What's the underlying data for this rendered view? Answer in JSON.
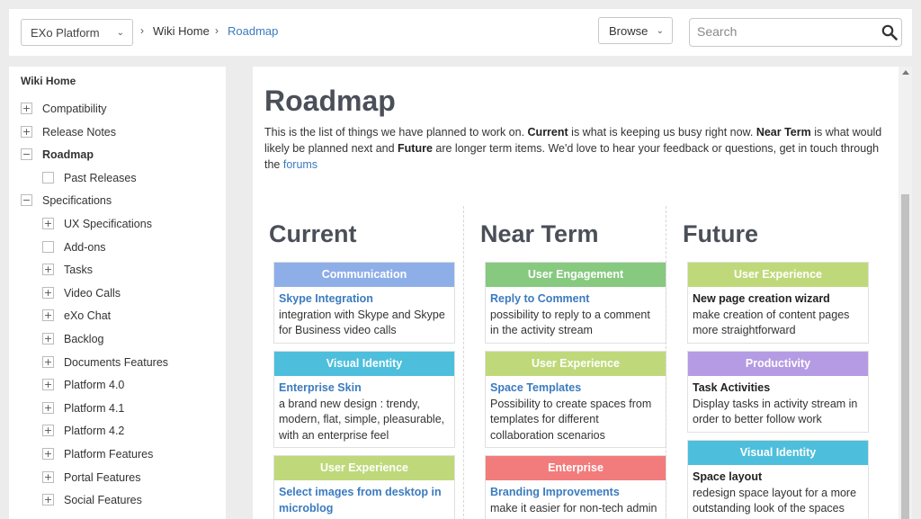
{
  "topbar": {
    "space_selector": "EXo Platform",
    "breadcrumb": [
      "Wiki Home",
      "Roadmap"
    ],
    "browse_label": "Browse",
    "search_placeholder": "Search"
  },
  "sidebar": {
    "title": "Wiki Home",
    "items": [
      {
        "label": "Compatibility",
        "toggle": "+",
        "level": 0,
        "bold": false
      },
      {
        "label": "Release Notes",
        "toggle": "+",
        "level": 0,
        "bold": false
      },
      {
        "label": "Roadmap",
        "toggle": "−",
        "level": 0,
        "bold": true
      },
      {
        "label": "Past Releases",
        "toggle": "",
        "level": 1,
        "bold": false
      },
      {
        "label": "Specifications",
        "toggle": "−",
        "level": 0,
        "bold": false
      },
      {
        "label": "UX Specifications",
        "toggle": "+",
        "level": 1,
        "bold": false
      },
      {
        "label": "Add-ons",
        "toggle": "",
        "level": 1,
        "bold": false
      },
      {
        "label": "Tasks",
        "toggle": "+",
        "level": 1,
        "bold": false
      },
      {
        "label": "Video Calls",
        "toggle": "+",
        "level": 1,
        "bold": false
      },
      {
        "label": "eXo Chat",
        "toggle": "+",
        "level": 1,
        "bold": false
      },
      {
        "label": "Backlog",
        "toggle": "+",
        "level": 1,
        "bold": false
      },
      {
        "label": "Documents Features",
        "toggle": "+",
        "level": 1,
        "bold": false
      },
      {
        "label": "Platform 4.0",
        "toggle": "+",
        "level": 1,
        "bold": false
      },
      {
        "label": "Platform 4.1",
        "toggle": "+",
        "level": 1,
        "bold": false
      },
      {
        "label": "Platform 4.2",
        "toggle": "+",
        "level": 1,
        "bold": false
      },
      {
        "label": "Platform Features",
        "toggle": "+",
        "level": 1,
        "bold": false
      },
      {
        "label": "Portal Features",
        "toggle": "+",
        "level": 1,
        "bold": false
      },
      {
        "label": "Social Features",
        "toggle": "+",
        "level": 1,
        "bold": false
      }
    ]
  },
  "main": {
    "title": "Roadmap",
    "intro": {
      "p1": "This is the list of things we have planned to work on. ",
      "b1": "Current",
      "p2": " is what is keeping us busy right now. ",
      "b2": "Near Term",
      "p3": " is what would likely be planned next and ",
      "b3": "Future",
      "p4": "  are longer term items. We'd love to hear your feedback or questions, get in touch through the ",
      "link": "forums"
    },
    "columns": [
      {
        "heading": "Current",
        "cards": [
          {
            "category": "Communication",
            "color": "#8eaee8",
            "title": "Skype Integration",
            "title_style": "link",
            "desc": " integration with Skype and Skype for Business video calls"
          },
          {
            "category": "Visual Identity",
            "color": "#4dbfdc",
            "title": "Enterprise Skin",
            "title_style": "link",
            "desc": " a brand new design : trendy, modern, flat, simple, pleasurable, with an enterprise feel"
          },
          {
            "category": "User Experience",
            "color": "#bfd97a",
            "title": "Select images from desktop in microblog",
            "title_style": "link",
            "desc": ""
          }
        ]
      },
      {
        "heading": "Near Term",
        "cards": [
          {
            "category": "User Engagement",
            "color": "#86c97f",
            "title": "Reply to Comment",
            "title_style": "link",
            "desc": "possibility to reply to a comment in the activity stream"
          },
          {
            "category": "User Experience",
            "color": "#bfd97a",
            "title": "Space Templates",
            "title_style": "link",
            "desc": "Possibility to create spaces from templates for different collaboration scenarios"
          },
          {
            "category": "Enterprise",
            "color": "#f27b7b",
            "title": "Branding Improvements",
            "title_style": "link",
            "desc": "make it easier for non-tech admin"
          }
        ]
      },
      {
        "heading": "Future",
        "cards": [
          {
            "category": "User Experience",
            "color": "#bfd97a",
            "title": "New page creation wizard",
            "title_style": "bold",
            "desc": "make creation of content pages more straightforward"
          },
          {
            "category": "Productivity",
            "color": "#b59be3",
            "title": "Task Activities",
            "title_style": "bold",
            "desc": "Display tasks in activity stream in order to better follow work"
          },
          {
            "category": "Visual Identity",
            "color": "#4dbfdc",
            "title": "Space layout",
            "title_style": "bold",
            "desc": "redesign space layout for a more outstanding look of the spaces"
          }
        ]
      }
    ]
  }
}
